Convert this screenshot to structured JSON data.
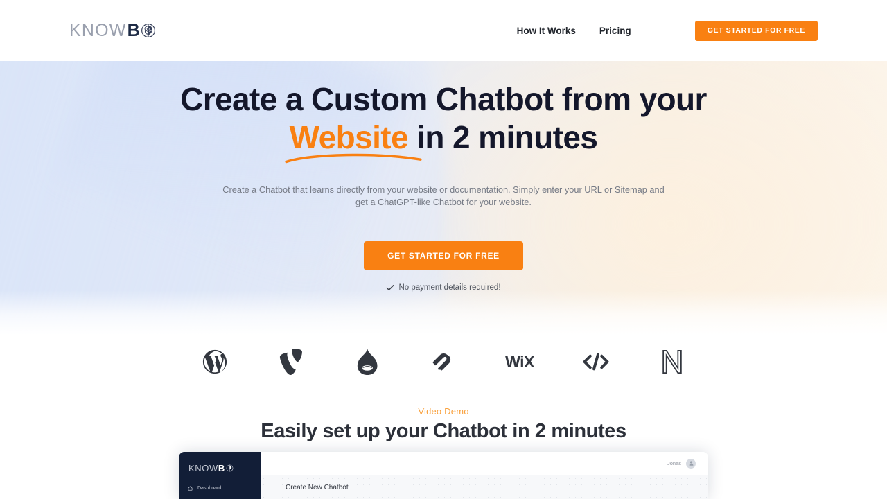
{
  "brand": {
    "name_light": "KNOWB",
    "name_bold": "B",
    "prefix": "KNOW",
    "icon": "brain-icon"
  },
  "colors": {
    "accent_orange": "#f98012",
    "eyebrow_orange": "#f9a23f",
    "heading_dark": "#14172b",
    "hero_blue": "#e3eaf8",
    "hero_cream": "#fdf6ec",
    "sidebar_navy": "#121e37"
  },
  "header": {
    "nav": [
      {
        "label": "How It Works"
      },
      {
        "label": "Pricing"
      }
    ],
    "cta_label": "GET STARTED FOR FREE"
  },
  "hero": {
    "title_line1": "Create a Custom Chatbot from your",
    "title_highlight": "Website",
    "title_line2_rest": " in 2 minutes",
    "subtitle_line1": "Create a Chatbot that learns directly from your website or documentation. Simply enter your URL or Sitemap",
    "subtitle_line2": "and get a ChatGPT-like Chatbot for your website.",
    "cta_label": "GET STARTED FOR FREE",
    "note": "No payment details required!",
    "note_icon": "check-icon"
  },
  "platforms": [
    {
      "name": "wordpress-logo",
      "label": "WordPress"
    },
    {
      "name": "typo3-logo",
      "label": "TYPO3"
    },
    {
      "name": "drupal-logo",
      "label": "Drupal"
    },
    {
      "name": "squarespace-logo",
      "label": "Squarespace"
    },
    {
      "name": "wix-logo",
      "label": "Wix"
    },
    {
      "name": "custom-code-logo",
      "label": "Custom Code"
    },
    {
      "name": "netlify-logo",
      "label": "N"
    }
  ],
  "demo": {
    "eyebrow": "Video Demo",
    "title": "Easily set up your Chatbot in 2 minutes"
  },
  "video_preview": {
    "logo_prefix": "KNOW",
    "logo_bold": "B",
    "sidebar_item": "Dashboard",
    "sidebar_icon": "home-icon",
    "user_name": "Jonas",
    "avatar_icon": "user-avatar-icon",
    "content_heading": "Create New Chatbot"
  }
}
